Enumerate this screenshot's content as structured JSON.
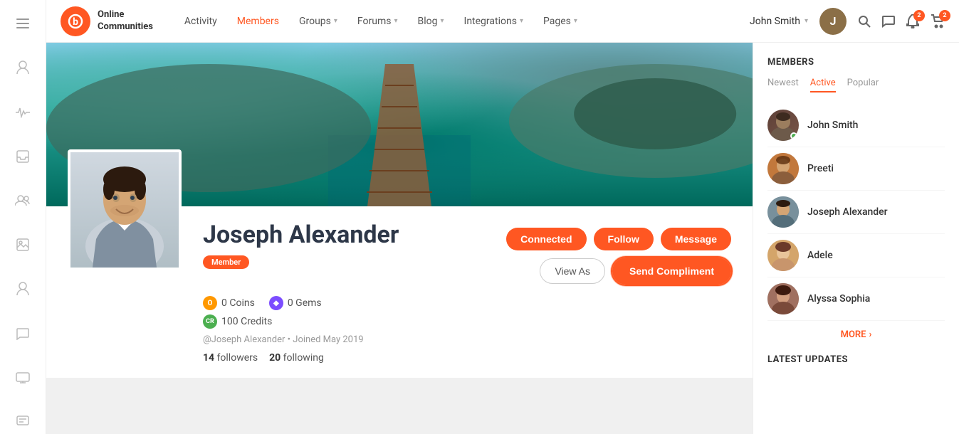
{
  "logo": {
    "text_line1": "Online",
    "text_line2": "Communities",
    "symbol": "b"
  },
  "nav": {
    "items": [
      {
        "label": "Activity",
        "active": false,
        "has_chevron": false
      },
      {
        "label": "Members",
        "active": true,
        "has_chevron": false
      },
      {
        "label": "Groups",
        "active": false,
        "has_chevron": true
      },
      {
        "label": "Forums",
        "active": false,
        "has_chevron": true
      },
      {
        "label": "Blog",
        "active": false,
        "has_chevron": true
      },
      {
        "label": "Integrations",
        "active": false,
        "has_chevron": true
      },
      {
        "label": "Pages",
        "active": false,
        "has_chevron": true
      }
    ],
    "user_name": "John Smith",
    "user_initial": "J",
    "notification_count": "2",
    "cart_count": "2"
  },
  "sidebar_left": {
    "icons": [
      {
        "name": "menu-icon",
        "symbol": "☰"
      },
      {
        "name": "user-icon",
        "symbol": "👤"
      },
      {
        "name": "activity-icon",
        "symbol": "⚡"
      },
      {
        "name": "inbox-icon",
        "symbol": "📥"
      },
      {
        "name": "group-icon",
        "symbol": "👥"
      },
      {
        "name": "image-icon",
        "symbol": "🖼"
      },
      {
        "name": "profile2-icon",
        "symbol": "👤"
      },
      {
        "name": "chat-icon",
        "symbol": "💬"
      },
      {
        "name": "monitor-icon",
        "symbol": "🖥"
      },
      {
        "name": "chat2-icon",
        "symbol": "💬"
      }
    ]
  },
  "profile": {
    "name": "Joseph Alexander",
    "badge": "Member",
    "handle": "@Joseph Alexander",
    "joined": "Joined May 2019",
    "followers": "14",
    "following": "20",
    "coins": "0 Coins",
    "gems": "0 Gems",
    "credits": "100 Credits",
    "buttons": {
      "connected": "Connected",
      "follow": "Follow",
      "message": "Message",
      "view_as": "View As",
      "send_compliment": "Send Compliment"
    }
  },
  "members_sidebar": {
    "title": "MEMBERS",
    "tabs": [
      {
        "label": "Newest",
        "active": false
      },
      {
        "label": "Active",
        "active": true
      },
      {
        "label": "Popular",
        "active": false
      }
    ],
    "members": [
      {
        "name": "John Smith",
        "avatar_class": "av-john",
        "online": true
      },
      {
        "name": "Preeti",
        "avatar_class": "av-preeti",
        "online": false
      },
      {
        "name": "Joseph Alexander",
        "avatar_class": "av-joseph",
        "online": false
      },
      {
        "name": "Adele",
        "avatar_class": "av-adele",
        "online": false
      },
      {
        "name": "Alyssa Sophia",
        "avatar_class": "av-alyssa",
        "online": false
      }
    ],
    "more_label": "MORE",
    "latest_updates_title": "LATEST UPDATES"
  }
}
